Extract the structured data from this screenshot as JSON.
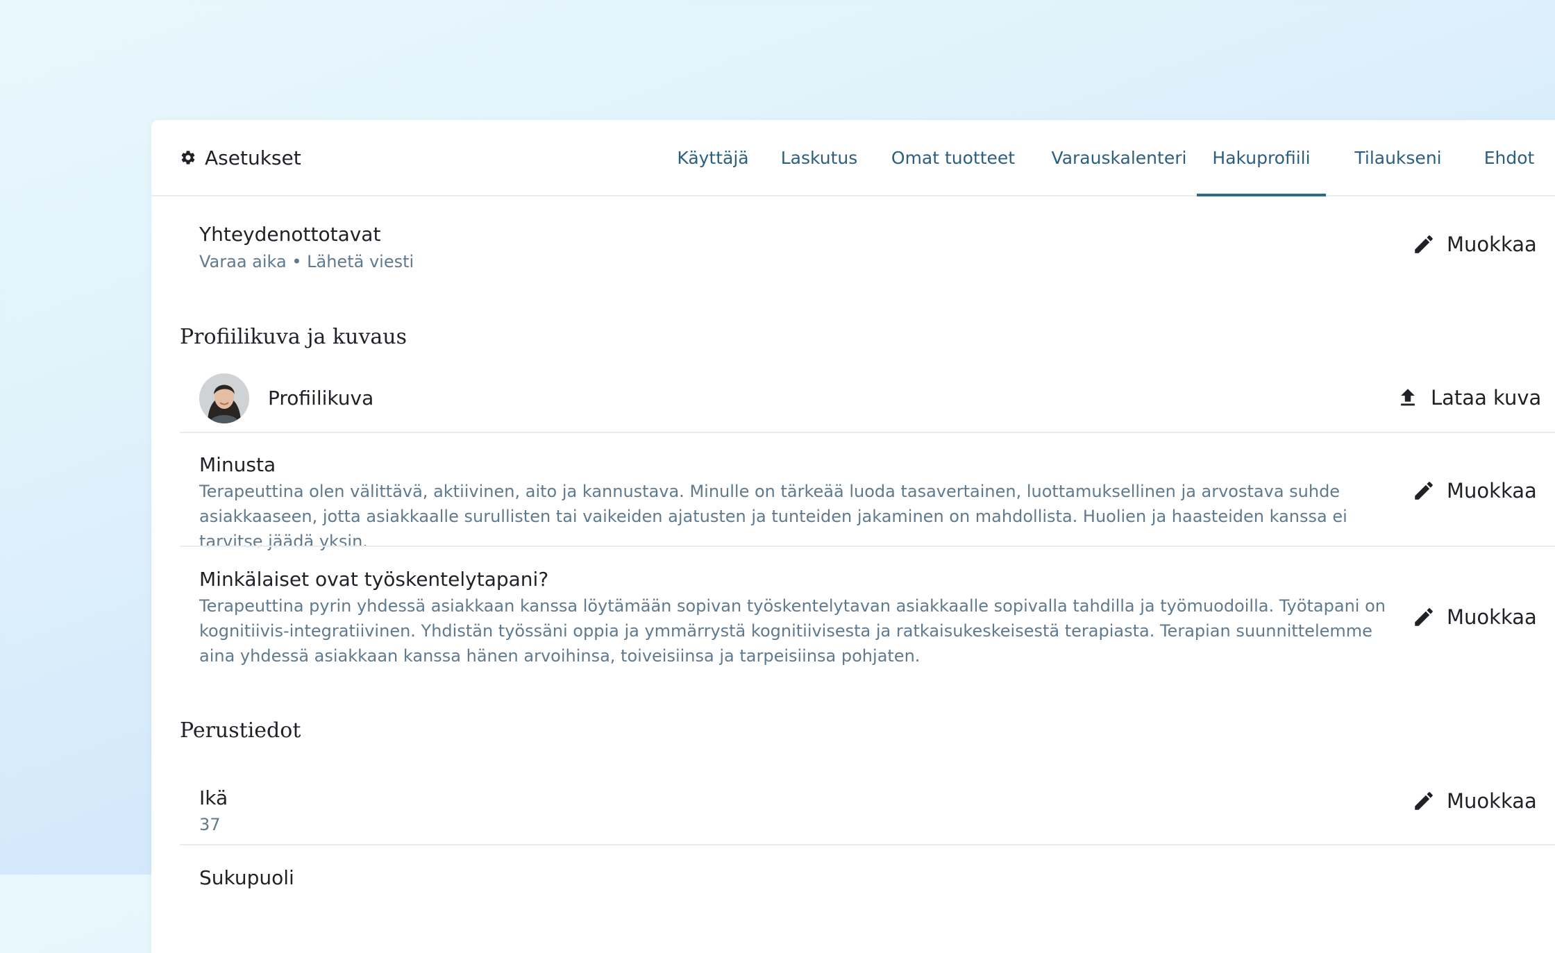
{
  "header": {
    "title": "Asetukset",
    "settings_icon": "gear-icon"
  },
  "tabs": [
    {
      "label": "Käyttäjä",
      "active": false
    },
    {
      "label": "Laskutus",
      "active": false
    },
    {
      "label": "Omat tuotteet",
      "active": false
    },
    {
      "label": "Varauskalenteri",
      "active": false
    },
    {
      "label": "Hakuprofiili",
      "active": true
    },
    {
      "label": "Tilaukseni",
      "active": false
    },
    {
      "label": "Ehdot",
      "active": false
    }
  ],
  "contact": {
    "title": "Yhteydenottotavat",
    "value": "Varaa aika • Lähetä viesti",
    "action": "Muokkaa"
  },
  "profile_section": {
    "heading": "Profiilikuva ja kuvaus",
    "picture_label": "Profiilikuva",
    "upload_action": "Lataa kuva",
    "about": {
      "title": "Minusta",
      "text": "Terapeuttina olen välittävä, aktiivinen, aito ja kannustava. Minulle on tärkeää luoda tasavertainen, luottamuksellinen ja arvostava suhde asiakkaaseen, jotta asiakkaalle surullisten tai vaikeiden ajatusten ja tunteiden jakaminen on mahdollista. Huolien ja haasteiden kanssa ei tarvitse jäädä yksin.",
      "action": "Muokkaa"
    },
    "methods": {
      "title": "Minkälaiset ovat työskentelytapani?",
      "text": "Terapeuttina pyrin yhdessä asiakkaan kanssa löytämään sopivan työskentelytavan asiakkaalle sopivalla tahdilla ja työmuodoilla. Työtapani on kognitiivis-integratiivinen. Yhdistän työssäni oppia ja ymmärrystä kognitiivisesta ja ratkaisukeskeisestä terapiasta. Terapian suunnittelemme aina yhdessä asiakkaan kanssa hänen arvoihinsa, toiveisiinsa ja tarpeisiinsa pohjaten.",
      "action": "Muokkaa"
    }
  },
  "basic_section": {
    "heading": "Perustiedot",
    "age": {
      "title": "Ikä",
      "value": "37",
      "action": "Muokkaa"
    },
    "next_title": "Sukupuoli"
  },
  "colors": {
    "accent": "#2e6a8f",
    "tab_text": "#2c5f7f",
    "muted_text": "#5f7a8f"
  }
}
